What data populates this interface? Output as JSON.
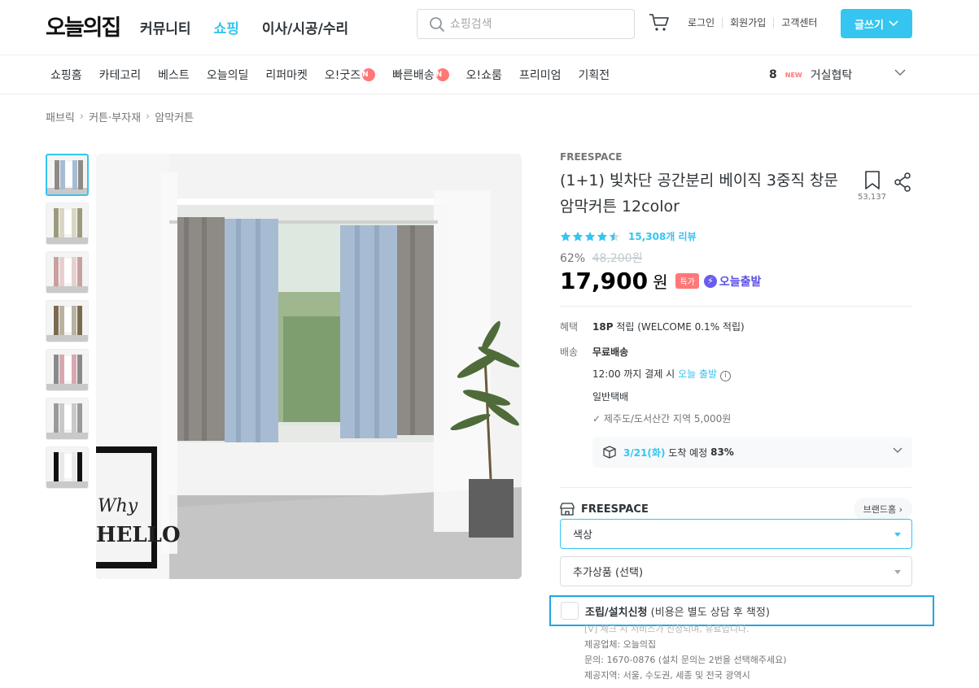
{
  "header": {
    "logo": "오늘의집",
    "nav": [
      "커뮤니티",
      "쇼핑",
      "이사/시공/수리"
    ],
    "active_nav": 1,
    "search_placeholder": "쇼핑검색",
    "util": [
      "로그인",
      "회원가입",
      "고객센터"
    ],
    "write_button": "글쓰기"
  },
  "subnav": {
    "items": [
      {
        "label": "쇼핑홈",
        "badge": ""
      },
      {
        "label": "카테고리",
        "badge": ""
      },
      {
        "label": "베스트",
        "badge": ""
      },
      {
        "label": "오늘의딜",
        "badge": ""
      },
      {
        "label": "리퍼마켓",
        "badge": ""
      },
      {
        "label": "오!굿즈",
        "badge": "N"
      },
      {
        "label": "빠른배송",
        "badge": "N"
      },
      {
        "label": "오!쇼룸",
        "badge": ""
      },
      {
        "label": "프리미엄",
        "badge": ""
      },
      {
        "label": "기획전",
        "badge": ""
      }
    ],
    "rank_number": "8",
    "rank_new": "NEW",
    "rank_keyword": "거실협탁"
  },
  "breadcrumb": [
    "패브릭",
    "커튼·부자재",
    "암막커튼"
  ],
  "product": {
    "brand": "FREESPACE",
    "title": "(1+1) 빛차단 공간분리 베이직 3중직 창문 암막커튼 12color",
    "bookmark_count": "53,137",
    "rating": 4.5,
    "review_count": "15,308개 리뷰",
    "discount": "62%",
    "original_price": "48,200원",
    "price": "17,900",
    "currency": "원",
    "special_tag": "특가",
    "express_label": "오늘출발",
    "benefit_label": "혜택",
    "benefit_points": "18P",
    "benefit_text": "적립 (WELCOME 0.1% 적립)",
    "shipping_label": "배송",
    "shipping_free": "무료배송",
    "shipping_cutoff_pre": "12:00 까지 결제 시",
    "shipping_cutoff_link": "오늘 출발",
    "shipping_type": "일반택배",
    "shipping_extra": "제주도/도서산간 지역 5,000원",
    "arrival_date": "3/21(화)",
    "arrival_text": "도착 예정",
    "arrival_pct": "83%",
    "seller_name": "FREESPACE",
    "brand_home": "브랜드홈"
  },
  "options": {
    "color_select": "색상",
    "addon_select": "추가상품 (선택)"
  },
  "install": {
    "title": "조립/설치신청",
    "note": "(비용은 별도 상담 후 책정)",
    "lines": [
      "[V] 체크 시 서비스가 신청되며, 유료입니다.",
      "제공업체: 오늘의집",
      "문의: 1670-0876 (설치 문의는 2번을 선택해주세요)",
      "제공지역: 서울, 수도권, 세종 및 전국 광역시"
    ]
  },
  "image_art": {
    "poster_text_1": "Why",
    "poster_text_2": "HELLO"
  },
  "colors": {
    "accent": "#35c5f0",
    "badge_red": "#ff7777",
    "express_purple": "#5b4ee5"
  }
}
